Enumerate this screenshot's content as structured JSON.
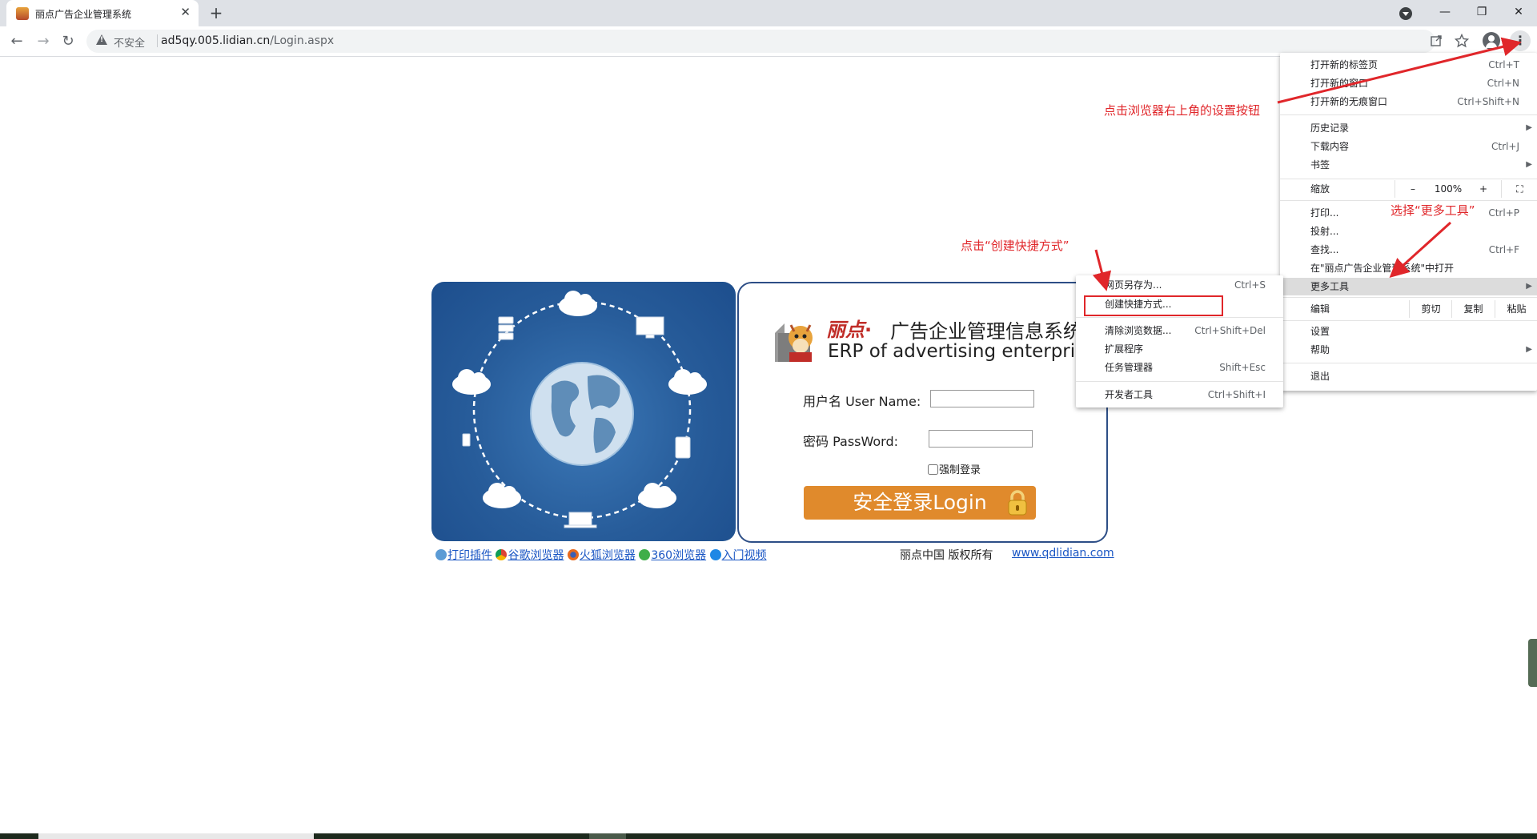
{
  "browser": {
    "tab_title": "丽点广告企业管理系统",
    "tab_close": "✕",
    "new_tab": "+",
    "window": {
      "minimize": "—",
      "restore": "❐",
      "close": "✕"
    },
    "nav": {
      "back": "←",
      "forward": "→",
      "reload": "↻"
    },
    "security_label": "不安全",
    "url_host": "ad5qy.005.lidian.cn",
    "url_path": "/Login.aspx",
    "menu_button": "⋮"
  },
  "login": {
    "brand": "丽点",
    "brand_dot": "·",
    "system_title": "广告企业管理信息系统",
    "erp_subtitle": "ERP of advertising enterprises",
    "username_label": "用户名 User Name:",
    "password_label": "密码 PassWord:",
    "force_login_label": "强制登录",
    "login_button": "安全登录Login",
    "links": [
      "打印插件",
      "谷歌浏览器",
      "火狐浏览器",
      "360浏览器",
      "入门视频"
    ],
    "copyright": "丽点中国 版权所有",
    "website": "www.qdlidian.com"
  },
  "main_menu": {
    "new_tab": {
      "label": "打开新的标签页",
      "shortcut": "Ctrl+T"
    },
    "new_window": {
      "label": "打开新的窗口",
      "shortcut": "Ctrl+N"
    },
    "incognito": {
      "label": "打开新的无痕窗口",
      "shortcut": "Ctrl+Shift+N"
    },
    "history": {
      "label": "历史记录"
    },
    "downloads": {
      "label": "下载内容",
      "shortcut": "Ctrl+J"
    },
    "bookmarks": {
      "label": "书签"
    },
    "zoom": {
      "label": "缩放",
      "minus": "–",
      "value": "100%",
      "plus": "+"
    },
    "print": {
      "label": "打印...",
      "shortcut": "Ctrl+P"
    },
    "cast": {
      "label": "投射..."
    },
    "find": {
      "label": "查找...",
      "shortcut": "Ctrl+F"
    },
    "open_in": {
      "label": "在\"丽点广告企业管理系统\"中打开"
    },
    "more_tools": {
      "label": "更多工具"
    },
    "edit": {
      "label": "编辑",
      "cut": "剪切",
      "copy": "复制",
      "paste": "粘贴"
    },
    "settings": {
      "label": "设置"
    },
    "help": {
      "label": "帮助"
    },
    "exit": {
      "label": "退出"
    }
  },
  "sub_menu": {
    "save_page": {
      "label": "网页另存为...",
      "shortcut": "Ctrl+S"
    },
    "create_shortcut": {
      "label": "创建快捷方式..."
    },
    "clear_data": {
      "label": "清除浏览数据...",
      "shortcut": "Ctrl+Shift+Del"
    },
    "extensions": {
      "label": "扩展程序"
    },
    "task_manager": {
      "label": "任务管理器",
      "shortcut": "Shift+Esc"
    },
    "dev_tools": {
      "label": "开发者工具",
      "shortcut": "Ctrl+Shift+I"
    }
  },
  "annotations": {
    "click_settings": "点击浏览器右上角的设置按钮",
    "select_more_tools": "选择“更多工具”",
    "click_create_shortcut": "点击“创建快捷方式”"
  },
  "colors": {
    "accent_red": "#e0262a",
    "login_orange": "#e08a2c",
    "panel_blue": "#275c9a",
    "link_blue": "#1a56c4"
  }
}
